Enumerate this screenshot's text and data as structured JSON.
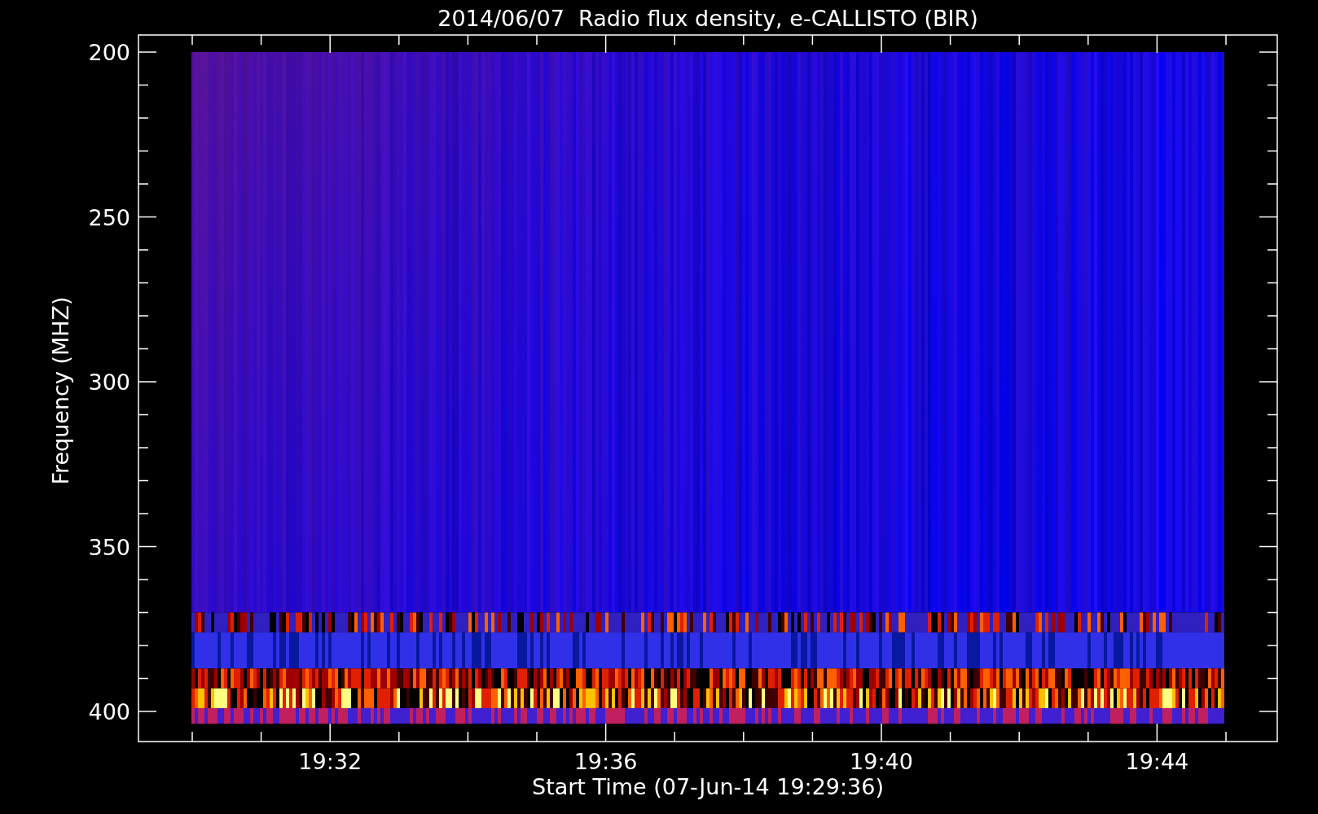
{
  "title": "2014/06/07  Radio flux density, e-CALLISTO (BIR)",
  "y_axis": {
    "label": "Frequency (MHZ)",
    "ticks": [
      "200",
      "250",
      "300",
      "350",
      "400"
    ]
  },
  "x_axis": {
    "label": "Start Time (07-Jun-14 19:29:36)",
    "ticks": [
      "19:32",
      "19:36",
      "19:40",
      "19:44"
    ]
  }
}
